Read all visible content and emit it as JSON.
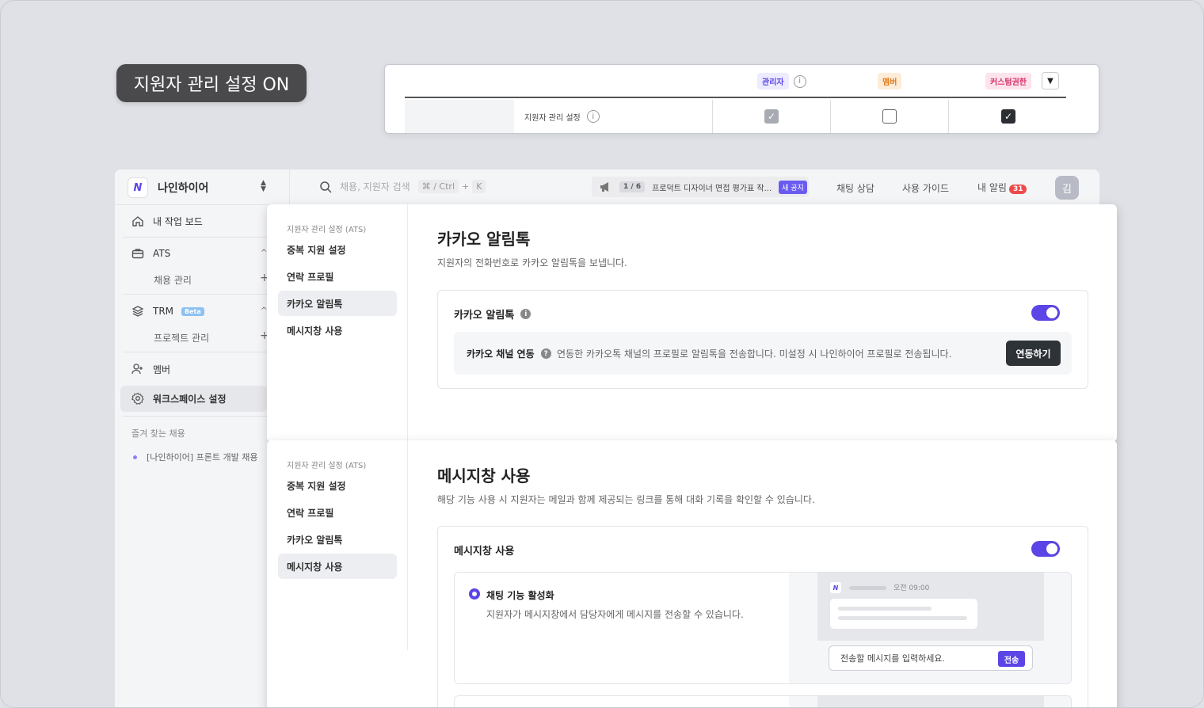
{
  "hero": {
    "label": "지원자 관리 설정 ON"
  },
  "permissions": {
    "roles": [
      {
        "label": "관리자",
        "bg": "#ecebff",
        "color": "#5b45e6"
      },
      {
        "label": "멤버",
        "bg": "#fdecd8",
        "color": "#e07b1c"
      },
      {
        "label": "커스텀권한",
        "bg": "#fde3ec",
        "color": "#d6336c"
      }
    ],
    "row_label": "지원자 관리 설정",
    "states": [
      "checked-disabled",
      "unchecked",
      "checked"
    ]
  },
  "topbar": {
    "workspace": "나인하이어",
    "logo": "N",
    "search_placeholder": "채용, 지원자 검색",
    "kbd1": "⌘ / Ctrl",
    "kbd_plus": "+",
    "kbd2": "K",
    "notice_count": "1 / 6",
    "notice_text": "프로덕트 디자이너 면접 평가표 작...",
    "notice_badge": "새 공지",
    "link_chat": "채팅 상담",
    "link_guide": "사용 가이드",
    "link_alarm": "내 알림",
    "alarm_count": "31",
    "avatar": "김"
  },
  "sidebar": {
    "dashboard": "내 작업 보드",
    "ats": "ATS",
    "ats_sub": "채용 관리",
    "trm": "TRM",
    "trm_badge": "Beta",
    "trm_sub": "프로젝트 관리",
    "member": "멤버",
    "workspace_settings": "워크스페이스 설정",
    "fav_head": "즐겨 찾는 채용",
    "fav_item": "[나인하이어] 프론트 개발 채용"
  },
  "panel_nav": {
    "head": "지원자 관리 설정 (ATS)",
    "items": [
      "중복 지원 설정",
      "연락 프로필",
      "카카오 알림톡",
      "메시지창 사용"
    ]
  },
  "kakao": {
    "title": "카카오 알림톡",
    "desc": "지원자의 전화번호로 카카오 알림톡을 보냅니다.",
    "box_title": "카카오 알림톡",
    "channel_label": "카카오 채널 연동",
    "channel_desc": "연동한 카카오톡 채널의 프로필로 알림톡을 전송합니다. 미설정 시 나인하이어 프로필로 전송됩니다.",
    "connect_button": "연동하기"
  },
  "messenger": {
    "title": "메시지창 사용",
    "desc": "해당 기능 사용 시 지원자는 메일과 함께 제공되는 링크를 통해 대화 기록을 확인할 수 있습니다.",
    "box_title": "메시지창 사용",
    "option_title": "채팅 기능 활성화",
    "option_desc": "지원자가 메시지창에서 담당자에게 메시지를 전송할 수 있습니다.",
    "preview_time": "오전 09:00",
    "preview_placeholder": "전송할 메시지를 입력하세요.",
    "preview_send": "전송"
  },
  "colors": {
    "accent": "#5b45e6",
    "dark_button": "#2e3338"
  }
}
